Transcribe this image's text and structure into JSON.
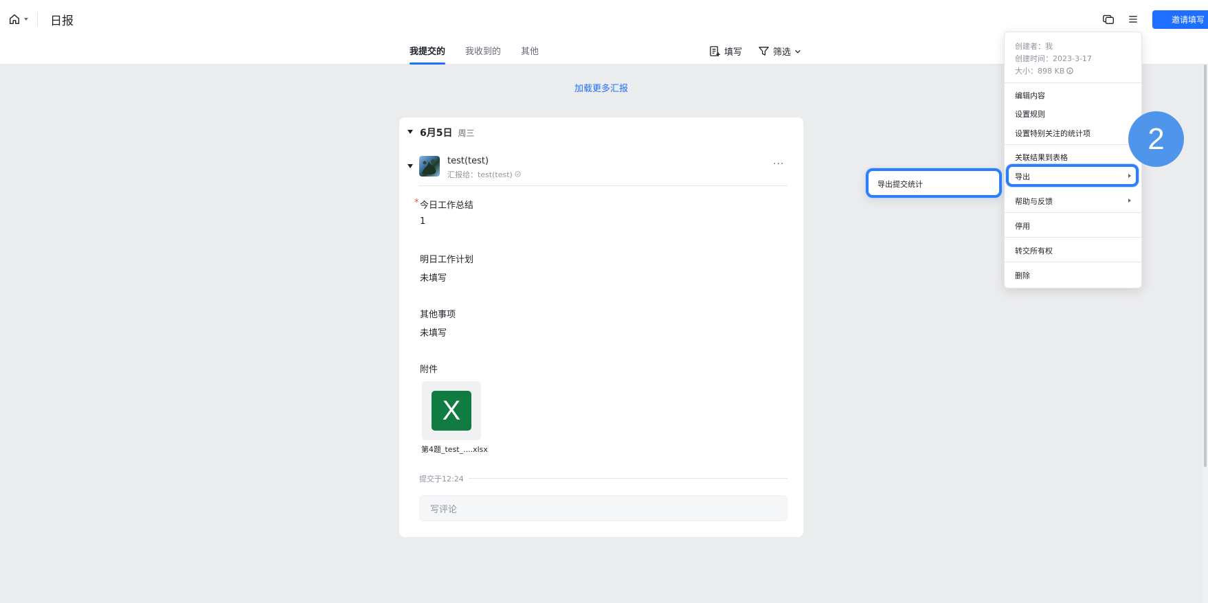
{
  "header": {
    "title": "日报",
    "invite_label": "邀请填写"
  },
  "tabs": [
    {
      "label": "我提交的",
      "active": true
    },
    {
      "label": "我收到的",
      "active": false
    },
    {
      "label": "其他",
      "active": false
    }
  ],
  "actions": {
    "fill_label": "填写",
    "filter_label": "筛选"
  },
  "load_more": "加载更多汇报",
  "report": {
    "date": "6月5日",
    "weekday": "周三",
    "user_name": "test(test)",
    "report_to": "汇报给：test(test)",
    "more": "···",
    "fields": [
      {
        "label": "今日工作总结",
        "required": true,
        "value": "1"
      },
      {
        "label": "明日工作计划",
        "required": false,
        "value": "未填写"
      },
      {
        "label": "其他事项",
        "required": false,
        "value": "未填写"
      }
    ],
    "attachment_label": "附件",
    "attachment": {
      "icon_letter": "X",
      "file_name": "第4题_test_....xlsx"
    },
    "submitted": "提交于12:24",
    "comment_placeholder": "写评论"
  },
  "menu": {
    "meta": {
      "creator": "创建者：我",
      "created_time": "创建时间：2023-3-17",
      "size": "大小：898 KB"
    },
    "items": [
      "编辑内容",
      "设置规则",
      "设置特别关注的统计项",
      "关联结果到表格",
      "导出",
      "帮助与反馈",
      "停用",
      "转交所有权",
      "删除"
    ],
    "submenu_item": "导出提交统计"
  },
  "step_badge": "2",
  "colors": {
    "accent": "#1e6fff",
    "highlight": "#2d7ff9",
    "badge": "#4f95ec",
    "excel": "#107c41"
  }
}
